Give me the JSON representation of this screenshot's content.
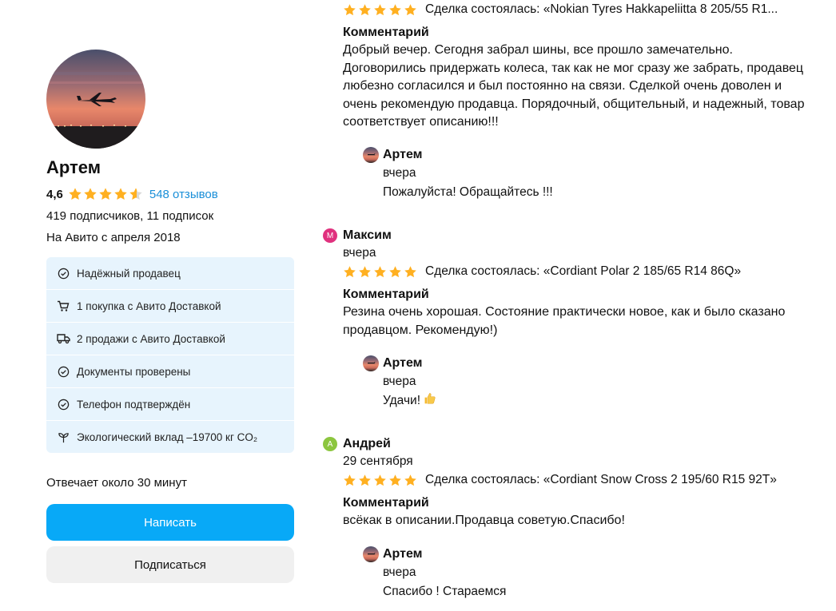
{
  "profile": {
    "name": "Артем",
    "rating": "4,6",
    "stars_value": 4.6,
    "reviews_link": "548 отзывов",
    "subscribers": "419 подписчиков, 11 подписок",
    "since": "На Авито с апреля 2018",
    "badges": [
      {
        "icon": "check-circle-icon",
        "label": "Надёжный продавец"
      },
      {
        "icon": "cart-icon",
        "label": "1 покупка с Авито Доставкой"
      },
      {
        "icon": "truck-icon",
        "label": "2 продажи с Авито Доставкой"
      },
      {
        "icon": "check-circle-icon",
        "label": "Документы проверены"
      },
      {
        "icon": "check-circle-icon",
        "label": "Телефон подтверждён"
      },
      {
        "icon": "sprout-icon",
        "label": "Экологический вклад –19700 кг CO₂"
      }
    ],
    "responds": "Отвечает около 30 минут",
    "write_button": "Написать",
    "subscribe_button": "Подписаться"
  },
  "reviews": [
    {
      "author": "",
      "date": "",
      "stars": 5,
      "deal": "Сделка состоялась: «Nokian Tyres Hakkapeliitta 8 205/55 R1...",
      "comment_label": "Комментарий",
      "comment": "Добрый вечер. Сегодня забрал шины, все прошло замечательно. Договорились придержать колеса, так как не мог сразу же забрать, продавец любезно согласился и был постоянно на связи. Сделкой очень доволен и очень рекомендую продавца. Порядочный, общительный, и надежный, товар соответствует описанию!!!",
      "reply": {
        "author": "Артем",
        "date": "вчера",
        "text": "Пожалуйста! Обращайтесь !!!"
      }
    },
    {
      "author": "Максим",
      "avatar_letter": "М",
      "avatar_color": "#e0317e",
      "date": "вчера",
      "stars": 5,
      "deal": "Сделка состоялась: «Cordiant Polar 2 185/65 R14 86Q»",
      "comment_label": "Комментарий",
      "comment": "Резина очень хорошая. Состояние практически новое, как и было сказано продавцом. Рекомендую!)",
      "reply": {
        "author": "Артем",
        "date": "вчера",
        "text": "Удачи!",
        "emoji": "thumbs-up-icon"
      }
    },
    {
      "author": "Андрей",
      "avatar_letter": "А",
      "avatar_color": "#8cc63f",
      "date": "29 сентября",
      "stars": 5,
      "deal": "Сделка состоялась: «Cordiant Snow Cross 2 195/60 R15 92T»",
      "comment_label": "Комментарий",
      "comment": "всёкак в описании.Продавца советую.Спасибо!",
      "reply": {
        "author": "Артем",
        "date": "вчера",
        "text": "Спасибо ! Стараемся"
      }
    }
  ],
  "colors": {
    "accent": "#08a9f7",
    "link": "#1a8fd8",
    "star": "#ffb021",
    "badge_bg": "#e7f4fd",
    "secondary_button": "#f0f0f0"
  }
}
